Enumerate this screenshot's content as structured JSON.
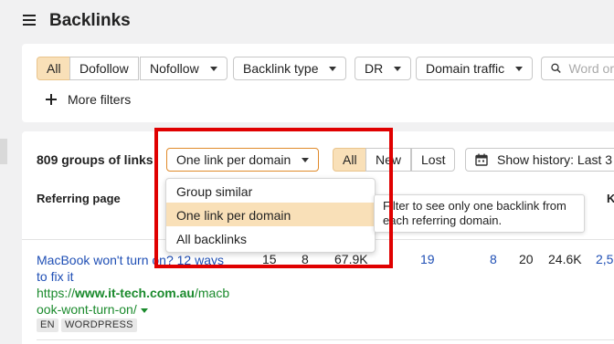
{
  "header": {
    "title": "Backlinks"
  },
  "filters": {
    "segments": [
      "All",
      "Dofollow",
      "Nofollow"
    ],
    "dropdowns": [
      "Backlink type",
      "DR",
      "Domain traffic"
    ],
    "search_placeholder": "Word or",
    "more_filters": "More filters"
  },
  "results": {
    "count_label": "809 groups of links",
    "grouping_value": "One link per domain",
    "segments": [
      "All",
      "New",
      "Lost"
    ],
    "history_label": "Show history: Last 3"
  },
  "dropdown_menu": {
    "items": [
      "Group similar",
      "One link per domain",
      "All backlinks"
    ],
    "selected": "One link per domain"
  },
  "tooltip": {
    "line1": "Filter to see only one backlink from",
    "line2": "each referring domain."
  },
  "table": {
    "columns": {
      "referring_page": "Referring page",
      "k": "K"
    },
    "row": {
      "title_line1": "MacBook won't turn on? 12 ways",
      "title_line2": "to fix it",
      "url_prefix": "https://",
      "url_domain": "www.it-tech.com.au",
      "url_path1": "/macb",
      "url_path2": "ook-wont-turn-on/",
      "tags": [
        "EN",
        "WORDPRESS"
      ],
      "values": [
        "15",
        "8",
        "67.9K",
        "19",
        "8",
        "20",
        "24.6K",
        "2,5"
      ]
    }
  },
  "colors": {
    "accent": "#f9e0b8",
    "link": "#1f4fb5",
    "url_green": "#1a8a2c",
    "highlight_box": "#e00000"
  }
}
